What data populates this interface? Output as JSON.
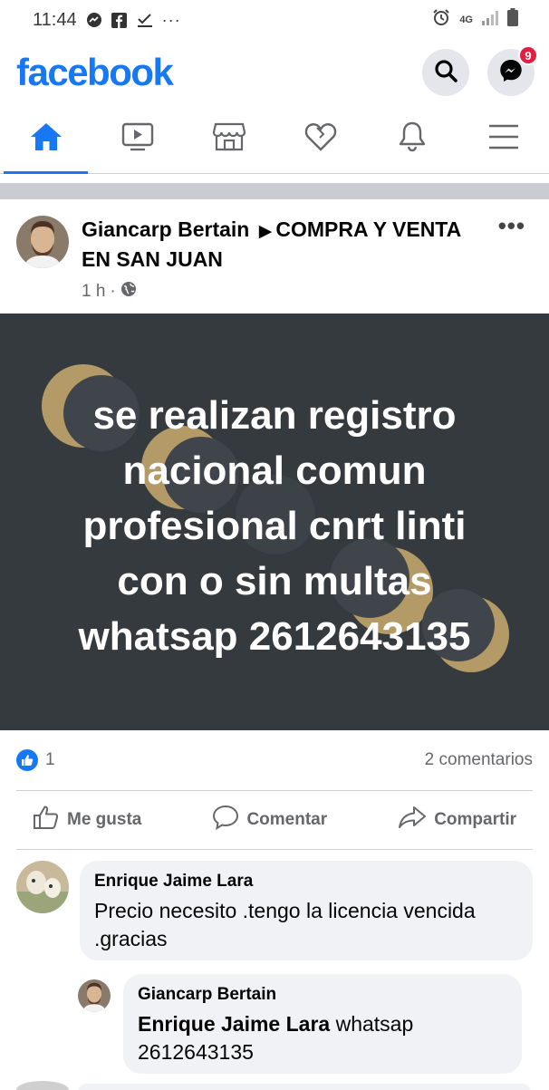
{
  "status_bar": {
    "time": "11:44",
    "left_icons": [
      "messenger-icon",
      "facebook-icon",
      "download-check-icon",
      "more-dots-icon"
    ],
    "ellipsis": "···",
    "network": "4G",
    "right_icons": [
      "alarm-icon",
      "signal-icon",
      "battery-icon"
    ]
  },
  "header": {
    "logo": "facebook",
    "messenger_badge": "9"
  },
  "nav": {
    "tabs": [
      {
        "name": "home",
        "active": true
      },
      {
        "name": "watch",
        "active": false
      },
      {
        "name": "marketplace",
        "active": false
      },
      {
        "name": "dating",
        "active": false
      },
      {
        "name": "notifications",
        "active": false
      },
      {
        "name": "menu",
        "active": false
      }
    ]
  },
  "post": {
    "author": "Giancarp Bertain",
    "group": "COMPRA Y VENTA EN SAN JUAN",
    "time": "1 h",
    "separator": "·",
    "more": "•••",
    "image_text_lines": [
      "se realizan registro",
      "nacional comun",
      "profesional cnrt linti",
      "con o sin multas",
      "whatsap 2612643135"
    ],
    "likes": "1",
    "comments_count": "2 comentarios",
    "actions": {
      "like": "Me gusta",
      "comment": "Comentar",
      "share": "Compartir"
    }
  },
  "comments": [
    {
      "name": "Enrique Jaime Lara",
      "text": "Precio necesito .tengo la licencia vencida .gracias"
    },
    {
      "name": "Giancarp Bertain",
      "mention": "Enrique Jaime Lara",
      "text": " whatsap 2612643135"
    }
  ],
  "colors": {
    "brand": "#1877f2",
    "image_bg": "#353a3f",
    "badge": "#e41e3f",
    "gold": "#b39a66"
  }
}
